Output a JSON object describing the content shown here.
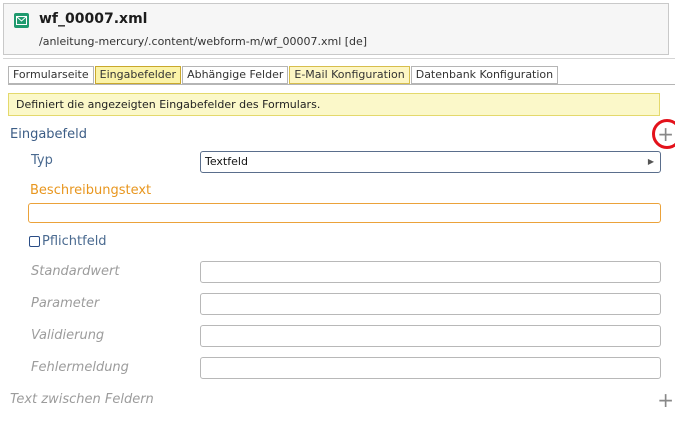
{
  "header": {
    "file_name": "wf_00007.xml",
    "file_path": "/anleitung-mercury/.content/webform-m/wf_00007.xml [de]",
    "icon": "mail-icon"
  },
  "tabs": [
    {
      "label": "Formularseite",
      "state": "normal"
    },
    {
      "label": "Eingabefelder",
      "state": "active"
    },
    {
      "label": "Abhängige Felder",
      "state": "normal"
    },
    {
      "label": "E-Mail Konfiguration",
      "state": "highlight"
    },
    {
      "label": "Datenbank Konfiguration",
      "state": "normal"
    }
  ],
  "info": "Definiert die angezeigten Eingabefelder des Formulars.",
  "section": {
    "title": "Eingabefeld",
    "add_icon": "plus-icon"
  },
  "fields": {
    "typ_label": "Typ",
    "typ_value": "Textfeld",
    "beschreibung_label": "Beschreibungstext",
    "beschreibung_value": "",
    "pflicht_label": "Pflichtfeld",
    "standardwert_label": "Standardwert",
    "parameter_label": "Parameter",
    "validierung_label": "Validierung",
    "fehlermeldung_label": "Fehlermeldung"
  },
  "text_between": "Text zwischen Feldern",
  "colors": {
    "accent": "#3c5d86",
    "highlight_label": "#e8961e",
    "annotation": "#e3121b",
    "icon_green": "#1f9a6e"
  }
}
